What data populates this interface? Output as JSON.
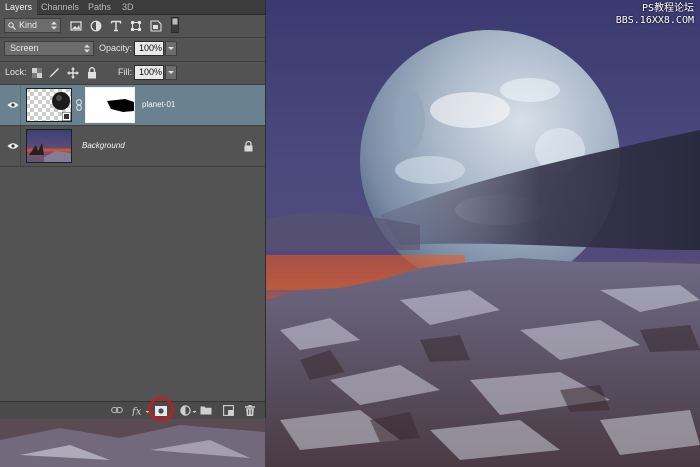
{
  "panel": {
    "tabs": [
      {
        "label": "Layers",
        "active": true
      },
      {
        "label": "Channels",
        "active": false
      },
      {
        "label": "Paths",
        "active": false
      },
      {
        "label": "3D",
        "active": false
      }
    ],
    "filter": {
      "label": "Kind"
    },
    "blend_mode": "Screen",
    "opacity_label": "Opacity:",
    "opacity_value": "100%",
    "lock_label": "Lock:",
    "fill_label": "Fill:",
    "fill_value": "100%",
    "layers": [
      {
        "name": "planet-01",
        "selected": true,
        "visible": true,
        "has_mask": true
      },
      {
        "name": "Background",
        "selected": false,
        "visible": true,
        "locked": true
      }
    ]
  },
  "watermark": {
    "line1": "PS教程论坛",
    "line2": "BBS.16XX8.COM"
  },
  "colors": {
    "panel_bg": "#535353",
    "selected_row": "#6a8190",
    "highlight_circle": "#d4141a"
  }
}
